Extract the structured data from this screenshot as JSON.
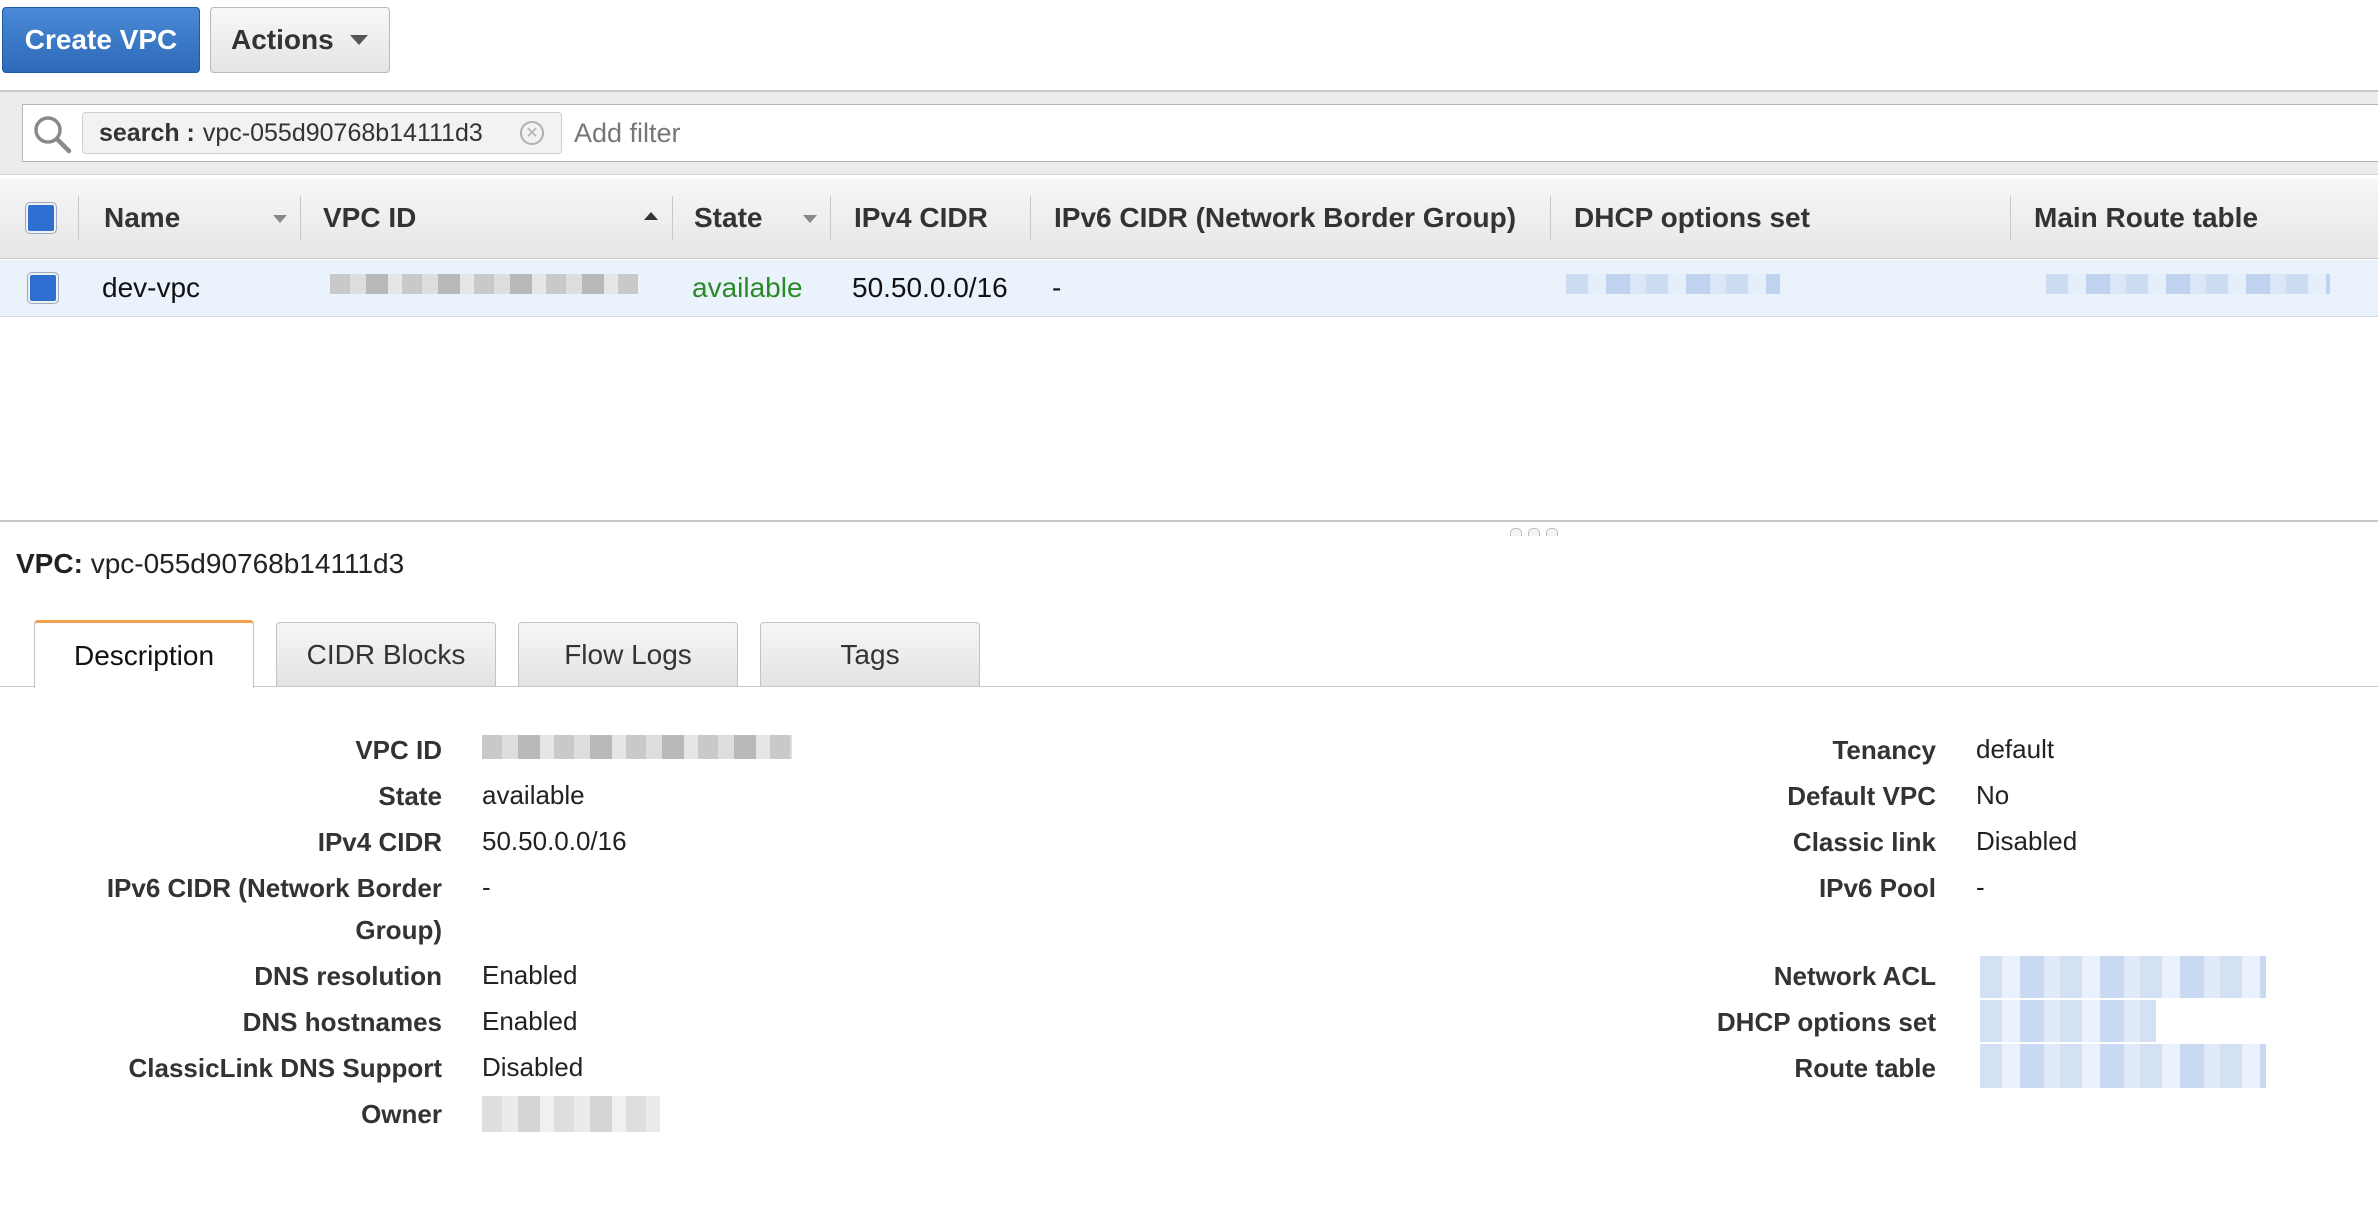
{
  "toolbar": {
    "create_label": "Create VPC",
    "actions_label": "Actions"
  },
  "filter": {
    "chip_key": "search :",
    "chip_value": "vpc-055d90768b14111d3",
    "clear_glyph": "✕",
    "add_filter_placeholder": "Add filter"
  },
  "table": {
    "columns": [
      "Name",
      "VPC ID",
      "State",
      "IPv4 CIDR",
      "IPv6 CIDR (Network Border Group)",
      "DHCP options set",
      "Main Route table"
    ],
    "rows": [
      {
        "name": "dev-vpc",
        "vpc_id": "[redacted]",
        "state": "available",
        "ipv4_cidr": "50.50.0.0/16",
        "ipv6_cidr": "-",
        "dhcp": "[redacted]",
        "route_table": "[redacted]"
      }
    ]
  },
  "detail": {
    "title_label": "VPC:",
    "title_value": "vpc-055d90768b14111d3",
    "tabs": [
      "Description",
      "CIDR Blocks",
      "Flow Logs",
      "Tags"
    ],
    "active_tab": "Description",
    "left": [
      {
        "label": "VPC ID",
        "value": ""
      },
      {
        "label": "State",
        "value": "available"
      },
      {
        "label": "IPv4 CIDR",
        "value": "50.50.0.0/16"
      },
      {
        "label": "IPv6 CIDR (Network Border Group)",
        "value": "-"
      },
      {
        "label": "DNS resolution",
        "value": "Enabled"
      },
      {
        "label": "DNS hostnames",
        "value": "Enabled"
      },
      {
        "label": "ClassicLink DNS Support",
        "value": "Disabled"
      },
      {
        "label": "Owner",
        "value": ""
      }
    ],
    "right": [
      {
        "label": "Tenancy",
        "value": "default"
      },
      {
        "label": "Default VPC",
        "value": "No"
      },
      {
        "label": "Classic link",
        "value": "Disabled"
      },
      {
        "label": "IPv6 Pool",
        "value": "-"
      },
      {
        "label": "Network ACL",
        "value": ""
      },
      {
        "label": "DHCP options set",
        "value": ""
      },
      {
        "label": "Route table",
        "value": ""
      }
    ]
  },
  "colors": {
    "primary": "#2d6ab8",
    "available_green": "#2a8a2a",
    "selected_row": "#eaf2fb",
    "active_tab_accent": "#f0a050"
  }
}
